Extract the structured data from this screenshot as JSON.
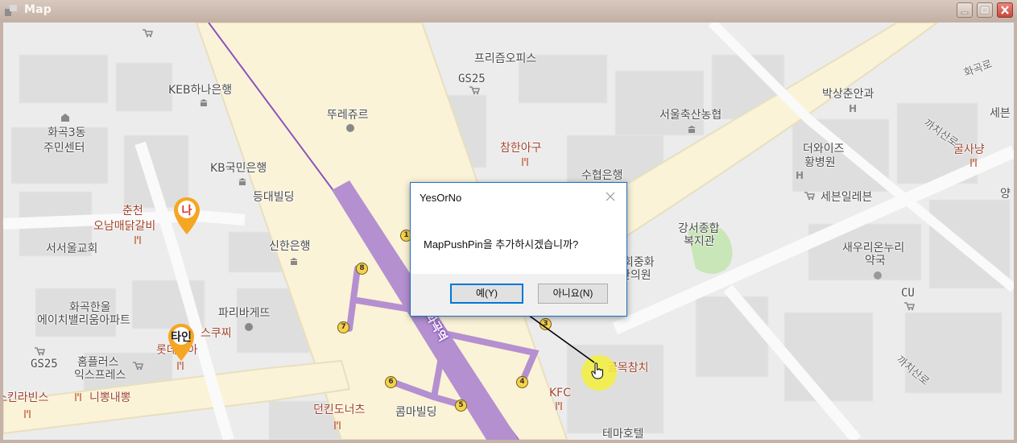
{
  "window": {
    "title": "Map",
    "controls": [
      "minimize",
      "maximize",
      "close"
    ]
  },
  "map": {
    "labels": [
      {
        "text": "프리즘오피스"
      },
      {
        "text": "GS25"
      },
      {
        "text": "KEB하나은행"
      },
      {
        "text": "뚜레쥬르"
      },
      {
        "text": "서울축산농협"
      },
      {
        "text": "박상춘안과"
      },
      {
        "text": "화곡로"
      },
      {
        "text": "세븐"
      },
      {
        "text": "화곡3동"
      },
      {
        "text": "주민센터"
      },
      {
        "text": "참한아구"
      },
      {
        "text": "수협은행"
      },
      {
        "text": "더와이즈"
      },
      {
        "text": "황병원"
      },
      {
        "text": "까치산로"
      },
      {
        "text": "굴사냥"
      },
      {
        "text": "KB국민은행"
      },
      {
        "text": "등대빌딩"
      },
      {
        "text": "세븐일레븐"
      },
      {
        "text": "춘천"
      },
      {
        "text": "오남매닭갈비"
      },
      {
        "text": "강서종합"
      },
      {
        "text": "복지관"
      },
      {
        "text": "서서울교회"
      },
      {
        "text": "신한은행"
      },
      {
        "text": "새우리온누리"
      },
      {
        "text": "약국"
      },
      {
        "text": "회중화"
      },
      {
        "text": "한의원"
      },
      {
        "text": "화곡한울"
      },
      {
        "text": "에이치밸리움아파트"
      },
      {
        "text": "파리바게뜨"
      },
      {
        "text": "CU"
      },
      {
        "text": "스쿠찌"
      },
      {
        "text": "롯데리아"
      },
      {
        "text": "GS25"
      },
      {
        "text": "홈플러스"
      },
      {
        "text": "익스프레스"
      },
      {
        "text": "골목참치"
      },
      {
        "text": "스킨라빈스"
      },
      {
        "text": "니뽕내뽕"
      },
      {
        "text": "KFC"
      },
      {
        "text": "던킨도너츠"
      },
      {
        "text": "콤마빌딩"
      },
      {
        "text": "테마호텔"
      },
      {
        "text": "까치산로"
      },
      {
        "text": "화곡역"
      },
      {
        "text": "양"
      }
    ],
    "stations": [
      "1",
      "8",
      "7",
      "3",
      "4",
      "6",
      "5"
    ],
    "pins": [
      {
        "label": "나",
        "color": "#f5a623"
      },
      {
        "label": "타인",
        "color": "#f5a623"
      }
    ]
  },
  "dialog": {
    "title": "YesOrNo",
    "message": "MapPushPin을 추가하시겠습니까?",
    "yes_label": "예(Y)",
    "no_label": "아니요(N)"
  }
}
